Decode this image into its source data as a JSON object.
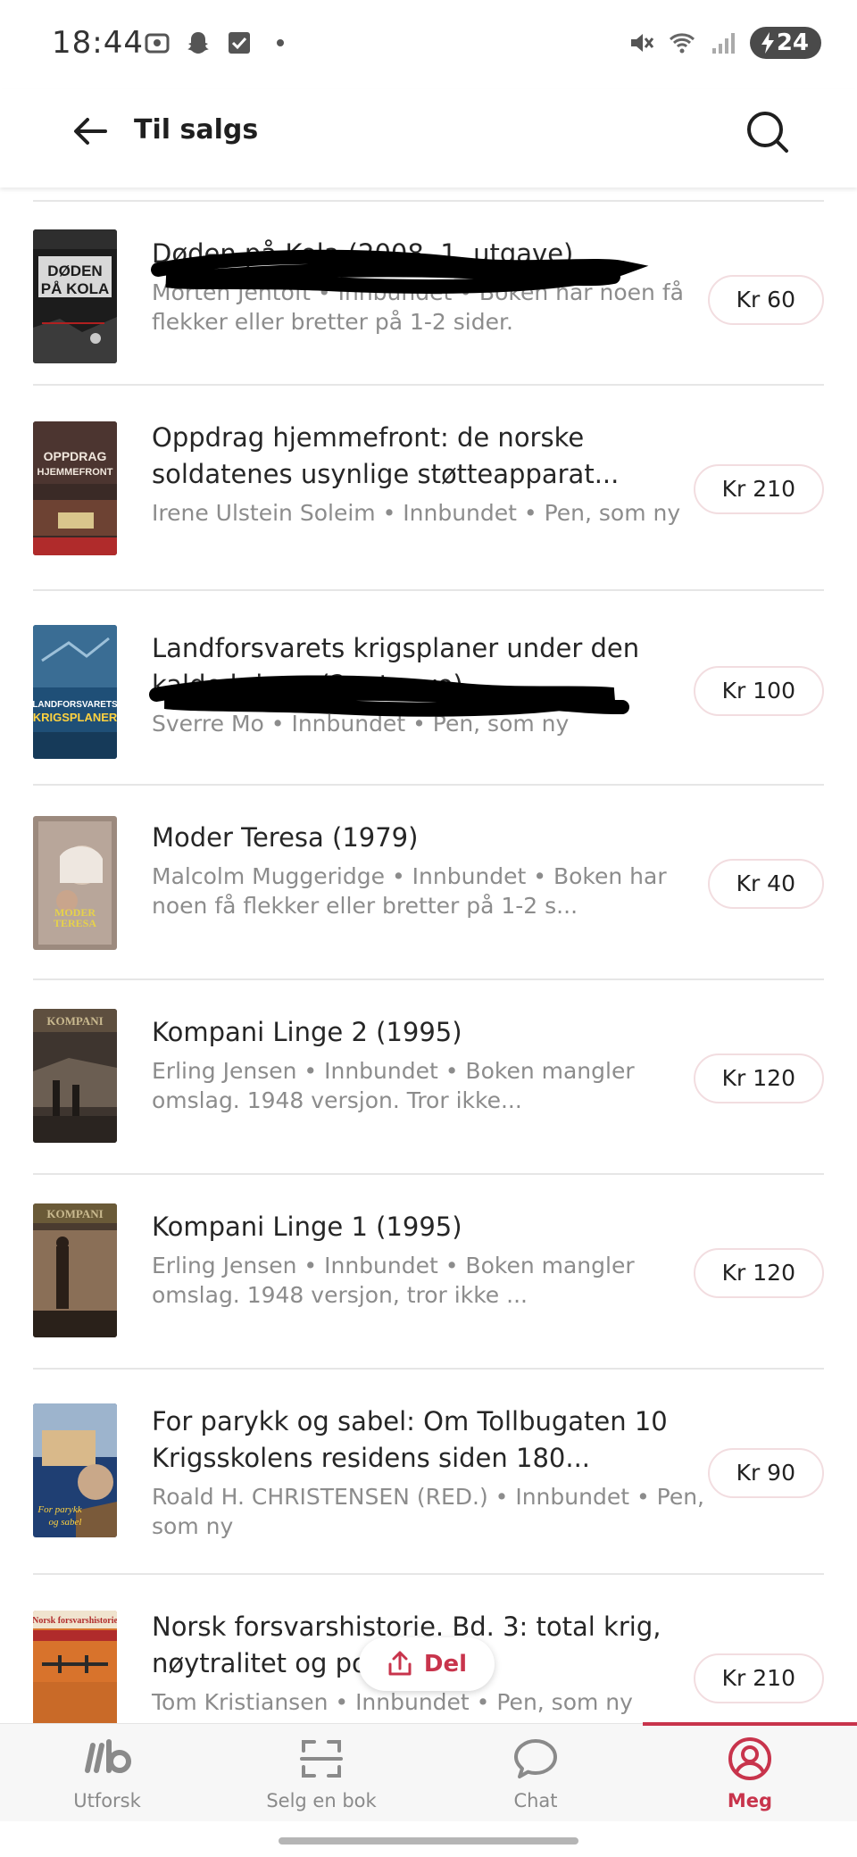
{
  "status_bar": {
    "time": "18:44",
    "battery": "24"
  },
  "app_bar": {
    "title": "Til salgs"
  },
  "listings": [
    {
      "title": "Døden på Kola (2008, 1. utgave)",
      "meta": "Morten Jentoft • Innbundet • Boken har noen få flekker eller bretter på 1-2 sider.",
      "price": "Kr 60",
      "cover_text": "DØDEN PÅ KOLA"
    },
    {
      "title": "Oppdrag hjemmefront: de norske soldatenes usynlige støtteapparat...",
      "meta": "Irene Ulstein Soleim • Innbundet • Pen, som ny",
      "price": "Kr 210",
      "cover_text": "OPPDRAG HJEMMEFRONT"
    },
    {
      "title": "Landforsvarets krigsplaner under den kalde krigen (2. utgave)",
      "meta": "Sverre Mo • Innbundet • Pen, som ny",
      "price": "Kr 100",
      "cover_text": "KRIGSPLANER"
    },
    {
      "title": "Moder Teresa (1979)",
      "meta": "Malcolm Muggeridge • Innbundet • Boken har noen få flekker eller bretter på 1-2 s...",
      "price": "Kr 40",
      "cover_text": "MODER TERESA"
    },
    {
      "title": "Kompani Linge 2 (1995)",
      "meta": "Erling Jensen • Innbundet • Boken mangler omslag. 1948 versjon. Tror ikke...",
      "price": "Kr 120",
      "cover_text": "KOMPANI"
    },
    {
      "title": "Kompani Linge 1 (1995)",
      "meta": "Erling Jensen • Innbundet • Boken mangler omslag. 1948 versjon, tror ikke ...",
      "price": "Kr 120",
      "cover_text": "KOMPANI"
    },
    {
      "title": "For parykk og sabel: Om Tollbugaten 10 Krigsskolens residens siden 180...",
      "meta": "Roald H. CHRISTENSEN (RED.) • Innbundet • Pen, som ny",
      "price": "Kr 90",
      "cover_text": "For parykk og sabel"
    },
    {
      "title": "Norsk forsvarshistorie. Bd. 3: total krig, nøytralitet og politisk s...",
      "meta": "Tom Kristiansen • Innbundet • Pen, som ny",
      "price": "Kr 210",
      "cover_text": "Norsk forsvarshistorie"
    }
  ],
  "share_button": {
    "label": "Del"
  },
  "bottom_nav": [
    {
      "label": "Utforsk",
      "icon": "utforsk-logo-icon"
    },
    {
      "label": "Selg en bok",
      "icon": "scan-icon"
    },
    {
      "label": "Chat",
      "icon": "chat-bubble-icon"
    },
    {
      "label": "Meg",
      "icon": "profile-icon"
    }
  ],
  "colors": {
    "accent": "#c8344c",
    "divider": "#e6e6e6",
    "meta_text": "#8c8c8c",
    "price_border": "#f2dde0"
  }
}
